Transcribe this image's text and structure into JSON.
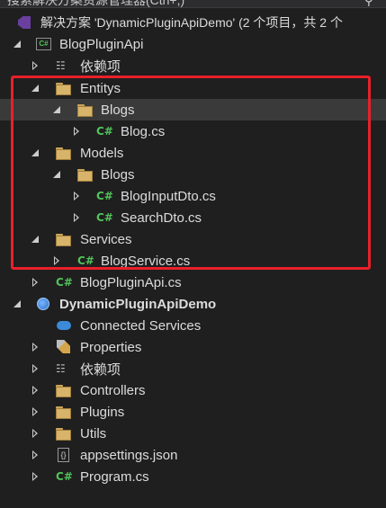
{
  "search": {
    "text": "搜索解决方案资源管理器(Ctrl+;)",
    "icon": "search-icon"
  },
  "tree": {
    "solution": "解决方案 'DynamicPluginApiDemo' (2 个项目，共 2 个",
    "project1": {
      "name": "BlogPluginApi",
      "dependencies": "依赖项",
      "entitys": "Entitys",
      "entitys_blogs": "Blogs",
      "blog_cs": "Blog.cs",
      "models": "Models",
      "models_blogs": "Blogs",
      "bloginputdto_cs": "BlogInputDto.cs",
      "searchdto_cs": "SearchDto.cs",
      "services": "Services",
      "blogservice_cs": "BlogService.cs",
      "blogpluginapi_cs": "BlogPluginApi.cs"
    },
    "project2": {
      "name": "DynamicPluginApiDemo",
      "connected_services": "Connected Services",
      "properties": "Properties",
      "dependencies": "依赖项",
      "controllers": "Controllers",
      "plugins": "Plugins",
      "utils": "Utils",
      "appsettings": "appsettings.json",
      "program_cs": "Program.cs"
    },
    "cs_badge": "C#",
    "proj_badge": "C#",
    "dep_glyph": "☷",
    "json_glyph": "{}"
  },
  "colors": {
    "highlight_border": "#e8202a",
    "selected_row": "#3a3a3a",
    "cs_green": "#52c35a",
    "folder": "#d7b46a"
  }
}
